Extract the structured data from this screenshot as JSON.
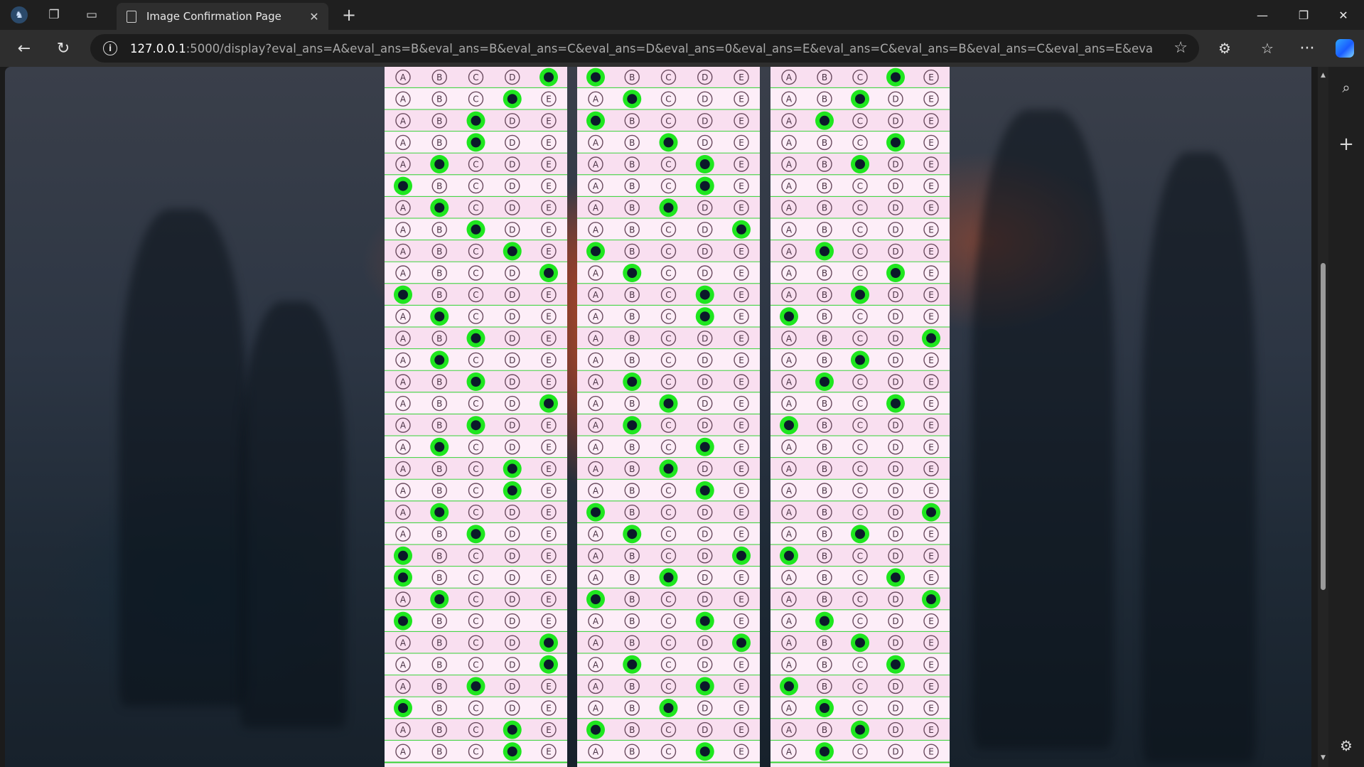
{
  "browser": {
    "tab_title": "Image Confirmation Page",
    "url_host": "127.0.0.1",
    "url_path": ":5000/display?eval_ans=A&eval_ans=B&eval_ans=B&eval_ans=C&eval_ans=D&eval_ans=0&eval_ans=E&eval_ans=C&eval_ans=B&eval_ans=C&eval_ans=E&eval_ans=D&eval_...",
    "icons": {
      "profile": "profile-icon",
      "workspaces": "workspaces-icon",
      "tab_actions": "tab-actions-icon",
      "new_tab": "+",
      "back": "←",
      "reload": "↻",
      "star": "☆",
      "more": "···"
    }
  },
  "answer_sheet": {
    "options": [
      "A",
      "B",
      "C",
      "D",
      "E"
    ],
    "fill_color": "#1fe61f",
    "dot_color": "#0b1a2a",
    "columns": [
      {
        "marked": [
          "",
          "E",
          "D",
          "C",
          "C",
          "B",
          "A",
          "B",
          "C",
          "D",
          "E",
          "A",
          "B",
          "C",
          "B",
          "C",
          "E",
          "C",
          "B",
          "D",
          "D",
          "B",
          "C",
          "A",
          "A",
          "B",
          "A",
          "E",
          "E",
          "C",
          "A",
          "D",
          "D"
        ]
      },
      {
        "marked": [
          "",
          "A",
          "B",
          "A",
          "C",
          "D",
          "D",
          "C",
          "E",
          "A",
          "B",
          "D",
          "D",
          "",
          "",
          "B",
          "C",
          "B",
          "D",
          "C",
          "D",
          "A",
          "B",
          "E",
          "C",
          "A",
          "D",
          "E",
          "B",
          "D",
          "C",
          "A",
          "D"
        ]
      },
      {
        "marked": [
          "",
          "D",
          "C",
          "B",
          "D",
          "C",
          "",
          "",
          "",
          "B",
          "D",
          "C",
          "A",
          "E",
          "C",
          "B",
          "D",
          "A",
          "",
          "",
          "",
          "E",
          "C",
          "A",
          "D",
          "E",
          "B",
          "C",
          "D",
          "A",
          "B",
          "C",
          "B"
        ]
      }
    ]
  }
}
